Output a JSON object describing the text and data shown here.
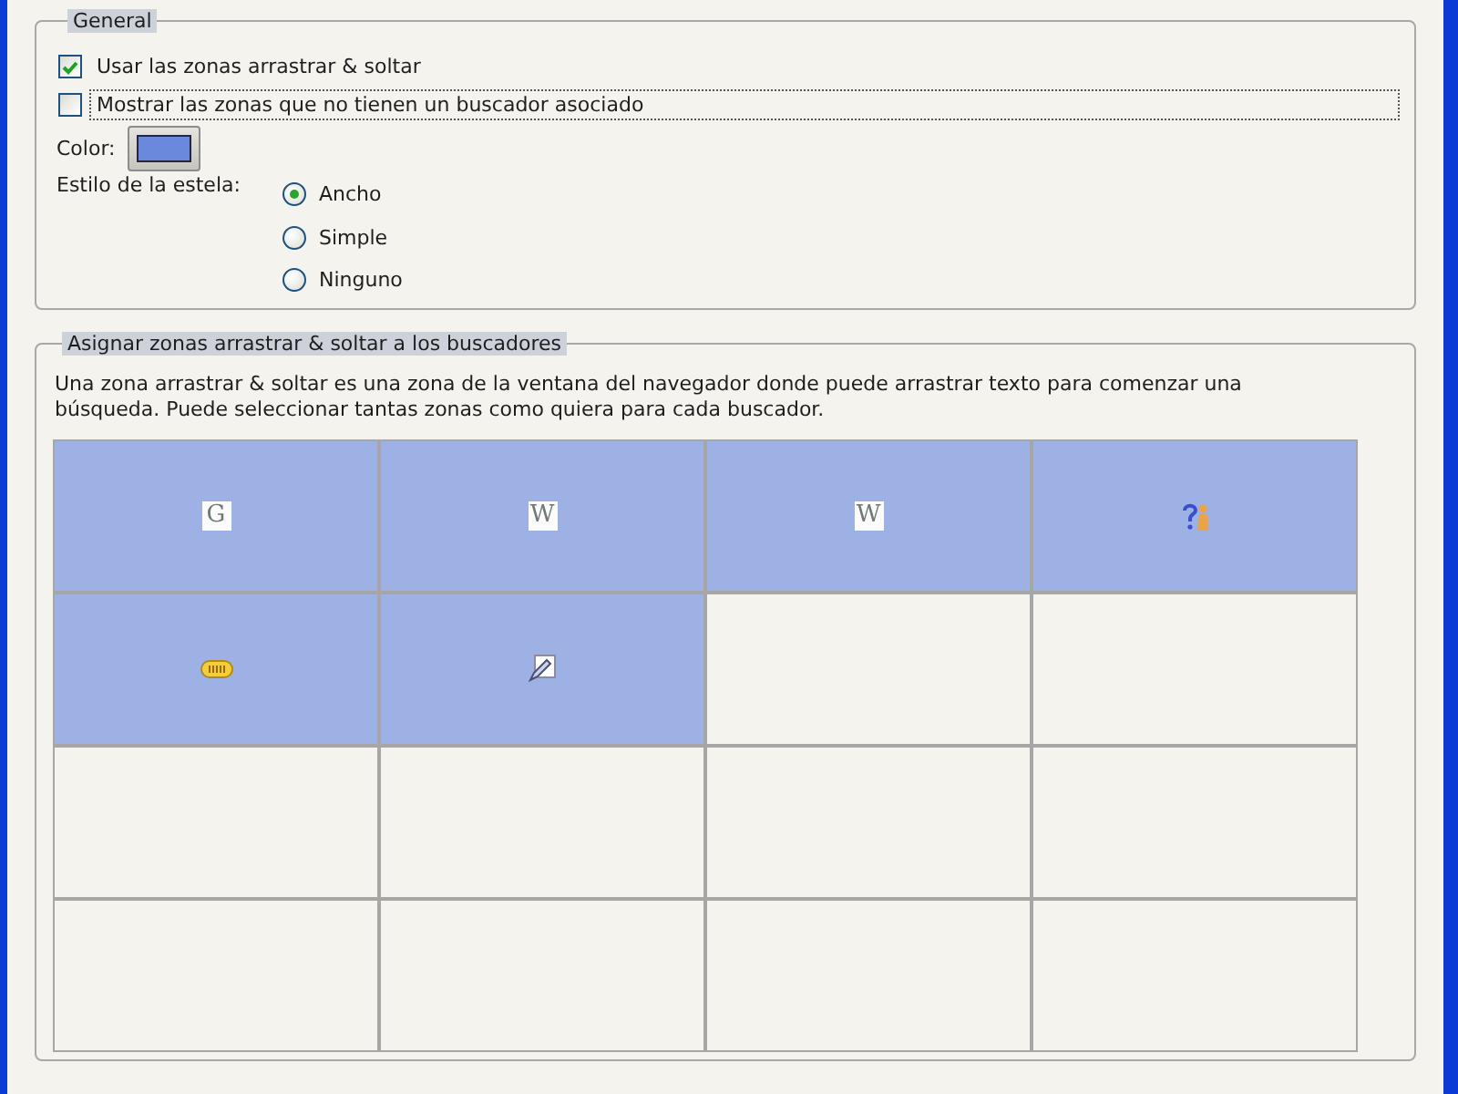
{
  "general": {
    "legend": "General",
    "options": [
      {
        "label": "Usar las zonas arrastrar & soltar",
        "checked": true,
        "focused": false
      },
      {
        "label": "Mostrar las zonas que no tienen un buscador asociado",
        "checked": false,
        "focused": true
      }
    ],
    "color_picker": {
      "label": "Color:",
      "color": "#6a88dc"
    },
    "trail_style": {
      "label": "Estilo de la estela:",
      "options": [
        {
          "label": "Ancho",
          "selected": true
        },
        {
          "label": "Simple",
          "selected": false
        },
        {
          "label": "Ninguno",
          "selected": false
        }
      ]
    }
  },
  "zones": {
    "legend": "Asignar zonas arrastrar & soltar a los buscadores",
    "description": "Una zona arrastrar & soltar es una zona de la ventana del navegador donde puede arrastrar texto para comenzar una búsqueda. Puede seleccionar tantas zonas como quiera para cada buscador.",
    "rows": [
      [
        {
          "selected": true,
          "engine": {
            "kind": "letter",
            "text": "G"
          }
        },
        {
          "selected": true,
          "engine": {
            "kind": "letter",
            "text": "W"
          }
        },
        {
          "selected": true,
          "engine": {
            "kind": "letter",
            "text": "W"
          }
        },
        {
          "selected": true,
          "engine": {
            "kind": "figure"
          }
        }
      ],
      [
        {
          "selected": true,
          "engine": {
            "kind": "badge"
          }
        },
        {
          "selected": true,
          "engine": {
            "kind": "page"
          }
        },
        {
          "selected": false
        },
        {
          "selected": false
        }
      ],
      [
        {
          "selected": false
        },
        {
          "selected": false
        },
        {
          "selected": false
        },
        {
          "selected": false
        }
      ],
      [
        {
          "selected": false
        },
        {
          "selected": false
        },
        {
          "selected": false
        },
        {
          "selected": false
        }
      ]
    ]
  }
}
